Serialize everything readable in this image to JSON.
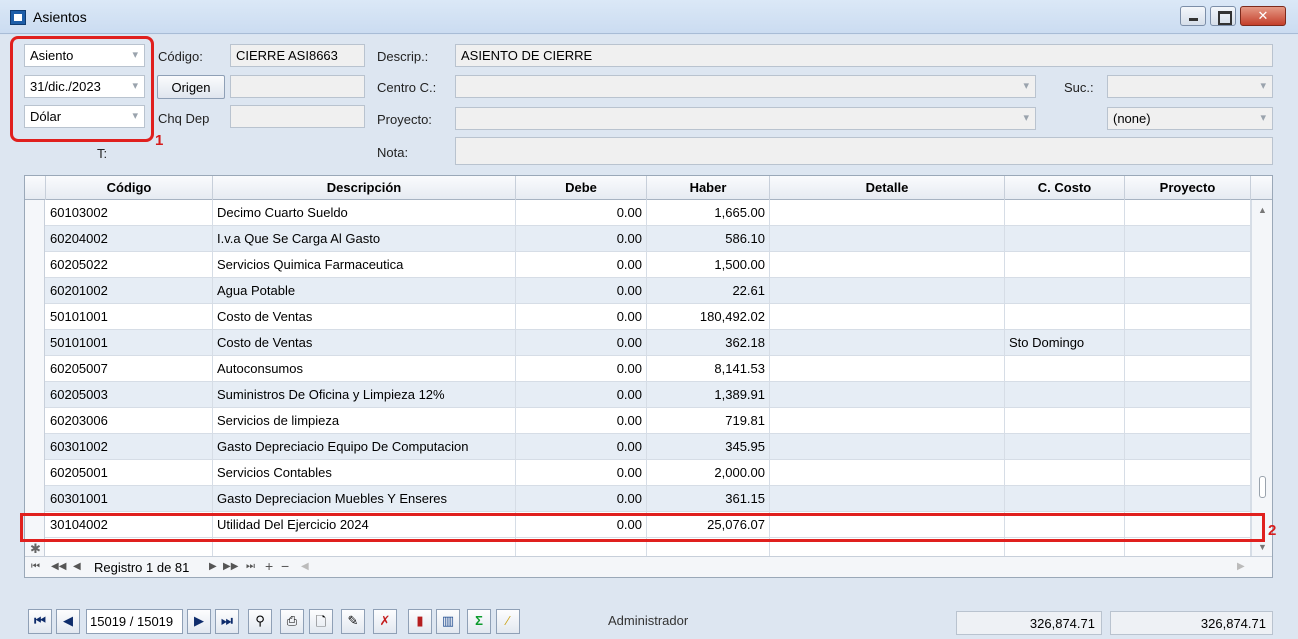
{
  "window": {
    "title": "Asientos"
  },
  "header": {
    "type_value": "Asiento",
    "date_value": "31/dic./2023",
    "currency_value": "Dólar",
    "t_label": "T:",
    "codigo_label": "Código:",
    "codigo_value": "CIERRE ASI8663",
    "origen_button": "Origen",
    "origen_value": "",
    "chq_label": "Chq Dep",
    "chq_value": "",
    "descrip_label": "Descrip.:",
    "descrip_value": "ASIENTO DE CIERRE",
    "centro_label": "Centro C.:",
    "centro_value": "",
    "proyecto_label": "Proyecto:",
    "proyecto_value": "",
    "nota_label": "Nota:",
    "nota_value": "",
    "suc_label": "Suc.:",
    "suc_value": "",
    "none_value": "(none)"
  },
  "annotations": {
    "mark1": "1",
    "mark2": "2"
  },
  "grid": {
    "columns": [
      "Código",
      "Descripción",
      "Debe",
      "Haber",
      "Detalle",
      "C. Costo",
      "Proyecto"
    ],
    "rows": [
      {
        "codigo": "60103002",
        "desc": "Decimo Cuarto Sueldo",
        "debe": "0.00",
        "haber": "1,665.00",
        "detalle": "",
        "costo": "",
        "proyecto": ""
      },
      {
        "codigo": "60204002",
        "desc": "I.v.a Que Se Carga Al Gasto",
        "debe": "0.00",
        "haber": "586.10",
        "detalle": "",
        "costo": "",
        "proyecto": ""
      },
      {
        "codigo": "60205022",
        "desc": "Servicios Quimica Farmaceutica",
        "debe": "0.00",
        "haber": "1,500.00",
        "detalle": "",
        "costo": "",
        "proyecto": ""
      },
      {
        "codigo": "60201002",
        "desc": "Agua Potable",
        "debe": "0.00",
        "haber": "22.61",
        "detalle": "",
        "costo": "",
        "proyecto": ""
      },
      {
        "codigo": "50101001",
        "desc": "Costo de Ventas",
        "debe": "0.00",
        "haber": "180,492.02",
        "detalle": "",
        "costo": "",
        "proyecto": ""
      },
      {
        "codigo": "50101001",
        "desc": "Costo de Ventas",
        "debe": "0.00",
        "haber": "362.18",
        "detalle": "",
        "costo": "Sto Domingo",
        "proyecto": ""
      },
      {
        "codigo": "60205007",
        "desc": "Autoconsumos",
        "debe": "0.00",
        "haber": "8,141.53",
        "detalle": "",
        "costo": "",
        "proyecto": ""
      },
      {
        "codigo": "60205003",
        "desc": "Suministros De Oficina y Limpieza 12%",
        "debe": "0.00",
        "haber": "1,389.91",
        "detalle": "",
        "costo": "",
        "proyecto": ""
      },
      {
        "codigo": "60203006",
        "desc": "Servicios de limpieza",
        "debe": "0.00",
        "haber": "719.81",
        "detalle": "",
        "costo": "",
        "proyecto": ""
      },
      {
        "codigo": "60301002",
        "desc": "Gasto Depreciacio Equipo De Computacion",
        "debe": "0.00",
        "haber": "345.95",
        "detalle": "",
        "costo": "",
        "proyecto": ""
      },
      {
        "codigo": "60205001",
        "desc": "Servicios Contables",
        "debe": "0.00",
        "haber": "2,000.00",
        "detalle": "",
        "costo": "",
        "proyecto": ""
      },
      {
        "codigo": "60301001",
        "desc": "Gasto Depreciacion Muebles Y Enseres",
        "debe": "0.00",
        "haber": "361.15",
        "detalle": "",
        "costo": "",
        "proyecto": ""
      },
      {
        "codigo": "30104002",
        "desc": "Utilidad Del Ejercicio 2024",
        "debe": "0.00",
        "haber": "25,076.07",
        "detalle": "",
        "costo": "",
        "proyecto": ""
      }
    ],
    "navigator_text": "Registro 1 de 81"
  },
  "footer": {
    "record_position": "15019 / 15019",
    "user": "Administrador",
    "total_debe": "326,874.71",
    "total_haber": "326,874.71"
  }
}
